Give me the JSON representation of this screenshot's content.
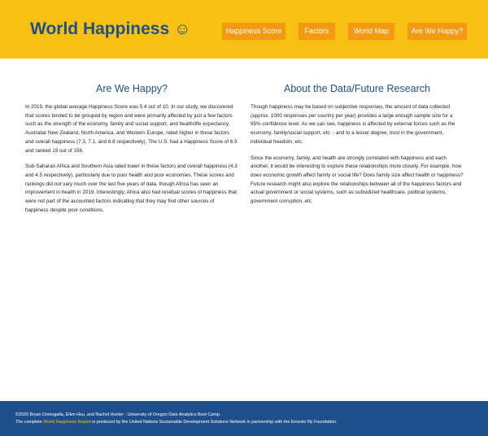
{
  "header": {
    "title": "World Happiness",
    "icon": "☺",
    "background": "#f7c012",
    "title_color": "#1d4f91"
  },
  "nav": {
    "items": [
      {
        "label": "Happiness Score"
      },
      {
        "label": "Factors"
      },
      {
        "label": "World Map"
      },
      {
        "label": "Are We Happy?"
      }
    ],
    "button_color": "#f39a12"
  },
  "main": {
    "left": {
      "heading": "Are We Happy?",
      "paragraphs": [
        "In 2019, the global average Happiness Score was 5.4 out of 10. In our study, we discovered that scores tended to be grouped by region and were primarily affected by just a few factors such as the strength of the economy, family and social support, and health/life expectancy. Australia/ New Zealand, North America, and Western Europe, rated higher in these factors and overall happiness (7.3, 7.1, and 6.8 respectively). The U.S. had a Happiness Score of 6.9 and ranked 19 out of 156.",
        "Sub-Saharan Africa and Southern Asia rated lower in these factors and overall happiness (4.3 and 4.5 respectively), particularly due to poor health and poor economies. These scores and rankings did not vary much over the last five years of data, though Africa has seen an improvement in health in 2019. Interestingly, Africa also had residual scores of happiness that were not part of the accounted factors indicating that they may find other sources of happiness despite poor conditions."
      ]
    },
    "right": {
      "heading": "About the Data/Future Research",
      "paragraphs": [
        "Though happiness may be based on subjective responses, the amount of data collected (approx. 1000 responses per country per year) provides a large enough sample size for a 95% confidence level. As we can see, happiness is affected by external forces such as the economy, family/social support, etc. - and to a lesser degree, trust in the government, individual freedom, etc.",
        "Since the economy, family, and health are strongly correlated with happiness and each another, it would be interesting to explore these relationships more closely. For example, how does economic growth affect family or social life? Does family size affect health or happiness? Future research might also explore the relationships between all of the happiness factors and actual government or social systems, such as subsidized healthcare, political systems, government corruption, etc."
      ]
    }
  },
  "footer": {
    "credits": "©2020 Bryan Domogalla, Ellen Hsu, and Rachel Hunter - University of Oregon Data Analytics Boot Camp.",
    "prefix": "The complete ",
    "link_text": "World Happiness Report",
    "suffix": " is produced by the United Nations Sustainable Development Solutions Network in partnership with the Ernesto Illy Foundation.",
    "background": "#1e4f8c",
    "link_color": "#f7c012"
  }
}
